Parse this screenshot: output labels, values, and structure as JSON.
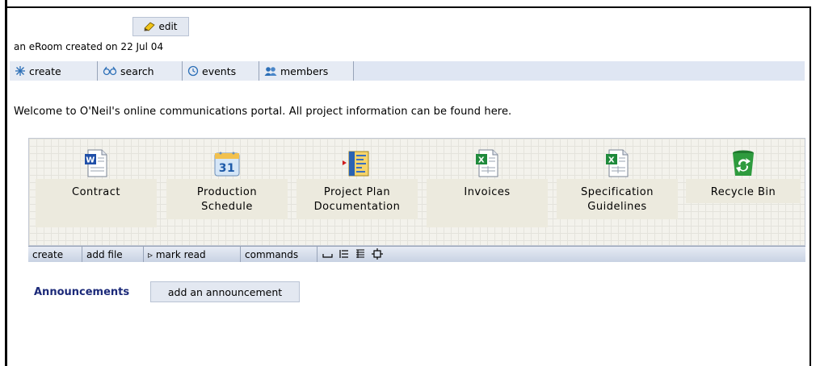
{
  "header": {
    "edit_label": "edit",
    "created_text": "an eRoom created on 22 Jul 04"
  },
  "toolbar": {
    "items": [
      {
        "label": "create",
        "icon": "sparkle-icon"
      },
      {
        "label": "search",
        "icon": "binoculars-icon"
      },
      {
        "label": "events",
        "icon": "clock-icon"
      },
      {
        "label": "members",
        "icon": "people-icon"
      }
    ]
  },
  "welcome_text": "Welcome to O'Neil's online communications portal.  All project information can be found here.",
  "items": [
    {
      "line1": "Contract",
      "line2": "",
      "icon": "word-document-icon"
    },
    {
      "line1": "Production",
      "line2": "Schedule",
      "icon": "calendar-icon"
    },
    {
      "line1": "Project Plan",
      "line2": "Documentation",
      "icon": "project-plan-icon"
    },
    {
      "line1": "Invoices",
      "line2": "",
      "icon": "excel-document-icon"
    },
    {
      "line1": "Specification",
      "line2": "Guidelines",
      "icon": "excel-document-icon"
    },
    {
      "line1": "Recycle Bin",
      "line2": "",
      "icon": "recycle-bin-icon"
    }
  ],
  "command_bar": {
    "create": "create",
    "add_file": "add file",
    "mark_read": "▹ mark read",
    "commands": "commands",
    "view_icons": [
      "list-view-icon",
      "detail-view-icon",
      "compact-view-icon",
      "settings-icon"
    ]
  },
  "announcements": {
    "label": "Announcements",
    "add_label": "add an announcement"
  },
  "colors": {
    "toolbar_bg": "#dfe6f3",
    "panel_bg": "#f3f2ec",
    "announcement_label": "#1c2a79"
  }
}
